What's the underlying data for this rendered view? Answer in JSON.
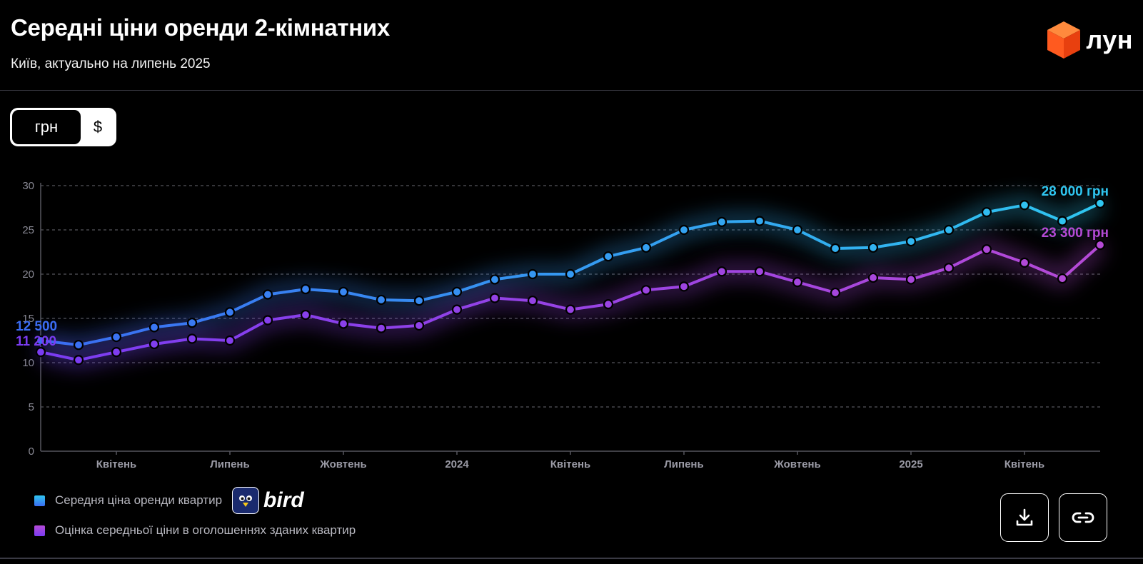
{
  "header": {
    "title": "Середні ціни оренди 2-кімнатних",
    "subtitle": "Київ, актуально на липень 2025",
    "logo_text": "лун",
    "logo_icon": "orange-cube-icon"
  },
  "currency_toggle": {
    "options": [
      "грн",
      "$"
    ],
    "selected": "грн"
  },
  "chart_data": {
    "type": "line",
    "ylim": [
      0,
      30
    ],
    "y_ticks": [
      "0",
      "5",
      "10",
      "15",
      "20",
      "25",
      "30"
    ],
    "grid": true,
    "x_labels": [
      {
        "index": 2,
        "label": "Квітень"
      },
      {
        "index": 5,
        "label": "Липень"
      },
      {
        "index": 8,
        "label": "Жовтень"
      },
      {
        "index": 11,
        "label": "2024"
      },
      {
        "index": 14,
        "label": "Квітень"
      },
      {
        "index": 17,
        "label": "Липень"
      },
      {
        "index": 20,
        "label": "Жовтень"
      },
      {
        "index": 23,
        "label": "2025"
      },
      {
        "index": 26,
        "label": "Квітень"
      }
    ],
    "series": [
      {
        "name": "Середня ціна оренди квартир",
        "color_start": "#3b6cf2",
        "color_end": "#2fc6f0",
        "start_label": "12 500",
        "end_label": "28 000 грн",
        "values": [
          12.5,
          12.0,
          12.9,
          14.0,
          14.5,
          15.7,
          17.7,
          18.3,
          18.0,
          17.1,
          17.0,
          18.0,
          19.4,
          20.0,
          20.0,
          22.0,
          23.0,
          25.0,
          25.9,
          26.0,
          25.0,
          22.9,
          23.0,
          23.7,
          25.0,
          27.0,
          27.8,
          26.0,
          28.0
        ]
      },
      {
        "name": "Оцінка середньої ціни в оголошеннях зданих квартир",
        "color_start": "#7a3cf2",
        "color_end": "#b54ad6",
        "start_label": "11 200",
        "end_label": "23 300 грн",
        "values": [
          11.2,
          10.3,
          11.2,
          12.1,
          12.7,
          12.5,
          14.8,
          15.4,
          14.4,
          13.9,
          14.2,
          16.0,
          17.3,
          17.0,
          16.0,
          16.6,
          18.2,
          18.6,
          20.3,
          20.3,
          19.1,
          17.9,
          19.6,
          19.4,
          20.7,
          22.8,
          21.3,
          19.5,
          23.3
        ]
      }
    ]
  },
  "legend": {
    "items": [
      {
        "label": "Середня ціна оренди квартир",
        "color": "#2aa3f0"
      },
      {
        "label": "Оцінка середньої ціни в оголошеннях зданих квартир",
        "color": "#8b3ee6"
      }
    ],
    "partner_text": "bird"
  },
  "actions": {
    "download_icon": "download-icon",
    "link_icon": "link-icon"
  }
}
